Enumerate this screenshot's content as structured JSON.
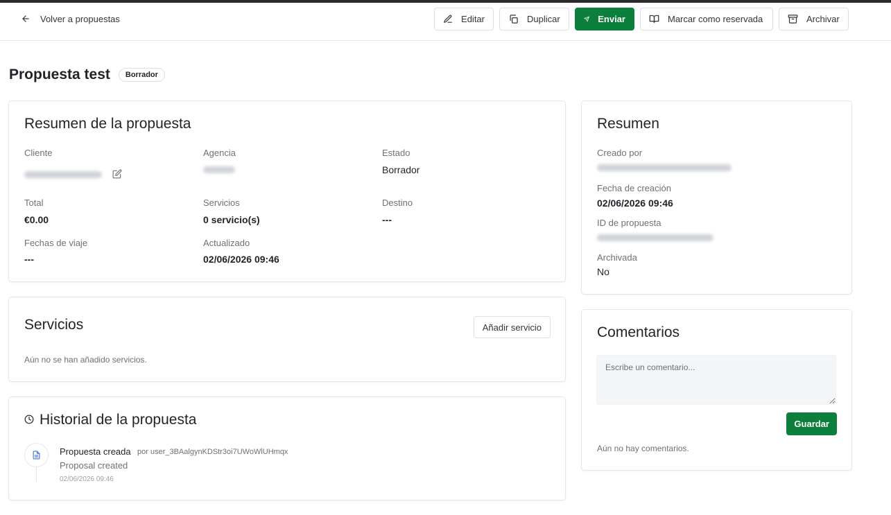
{
  "header": {
    "back_label": "Volver a propuestas",
    "actions": {
      "edit": "Editar",
      "duplicate": "Duplicar",
      "send": "Enviar",
      "reserve": "Marcar como reservada",
      "archive": "Archivar"
    }
  },
  "page": {
    "title": "Propuesta test",
    "status_badge": "Borrador"
  },
  "proposal_summary": {
    "title": "Resumen de la propuesta",
    "client_label": "Cliente",
    "agency_label": "Agencia",
    "status_label": "Estado",
    "status_value": "Borrador",
    "total_label": "Total",
    "total_value": "€0.00",
    "services_label": "Servicios",
    "services_value": "0 servicio(s)",
    "destination_label": "Destino",
    "destination_value": "---",
    "travel_dates_label": "Fechas de viaje",
    "travel_dates_value": "---",
    "updated_label": "Actualizado",
    "updated_value": "02/06/2026 09:46"
  },
  "services": {
    "title": "Servicios",
    "add_button": "Añadir servicio",
    "empty": "Aún no se han añadido servicios."
  },
  "history": {
    "title": "Historial de la propuesta",
    "entries": [
      {
        "title": "Propuesta creada",
        "by": "por user_3BAalgynKDStr3oi7UWoWlUHmqx",
        "description": "Proposal created",
        "timestamp": "02/06/2026 09:46"
      }
    ]
  },
  "summary": {
    "title": "Resumen",
    "created_by_label": "Creado por",
    "created_at_label": "Fecha de creación",
    "created_at_value": "02/06/2026 09:46",
    "proposal_id_label": "ID de propuesta",
    "archived_label": "Archivada",
    "archived_value": "No"
  },
  "comments": {
    "title": "Comentarios",
    "placeholder": "Escribe un comentario...",
    "save_button": "Guardar",
    "empty": "Aún no hay comentarios."
  },
  "colors": {
    "primary": "#0b7f3b",
    "border": "#e4e6ea"
  }
}
